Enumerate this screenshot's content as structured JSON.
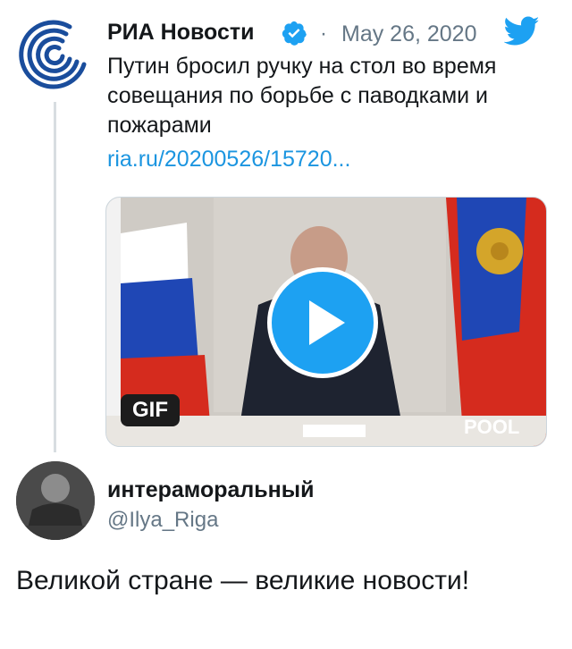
{
  "tweet": {
    "author_name": "РИА Новости",
    "separator": "·",
    "date": "May 26, 2020",
    "text": "Путин бросил ручку на стол во время совещания по борьбе с паводками и пожарами",
    "link": "ria.ru/20200526/15720...",
    "media": {
      "gif_label": "GIF",
      "watermark": "POOL"
    }
  },
  "reply": {
    "author_name": "интераморальный",
    "handle": "@Ilya_Riga",
    "text": "Великой стране — великие новости!"
  },
  "colors": {
    "link_blue": "#1b95e0",
    "verified_blue": "#1da1f2",
    "muted_gray": "#657786",
    "ria_blue": "#1a4d9c"
  },
  "icons": {
    "verified": "verified-badge-icon",
    "twitter": "twitter-bird-icon",
    "play": "play-icon"
  }
}
